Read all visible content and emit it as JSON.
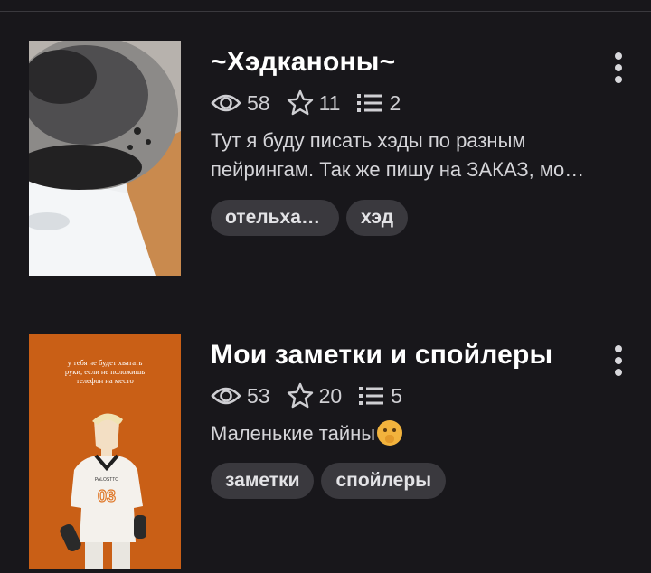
{
  "colors": {
    "background": "#18171b",
    "divider": "#3a393e",
    "tag_bg": "#3a393e",
    "book2_cover": "#c95f16"
  },
  "books": [
    {
      "title": "~Хэдканоны~",
      "views": "58",
      "likes": "11",
      "parts": "2",
      "description_line1": "Тут я буду писать хэды по разным",
      "description_line2": "пейрингам. Так же пишу на ЗАКАЗ, мо…",
      "tags": [
        "отельхазб…",
        "хэд"
      ],
      "icons": {
        "views": "eye-icon",
        "likes": "star-icon",
        "parts": "list-icon",
        "menu": "more-vertical-icon"
      }
    },
    {
      "title": "Мои заметки и спойлеры",
      "views": "53",
      "likes": "20",
      "parts": "5",
      "description": "Маленькие тайны",
      "description_emoji": "shushing-face-emoji",
      "tags": [
        "заметки",
        "спойлеры"
      ],
      "cover_text": "у тебя не будет хватать руки, если не положишь телефон на место",
      "cover_jersey_number": "03",
      "icons": {
        "views": "eye-icon",
        "likes": "star-icon",
        "parts": "list-icon",
        "menu": "more-vertical-icon"
      }
    }
  ]
}
